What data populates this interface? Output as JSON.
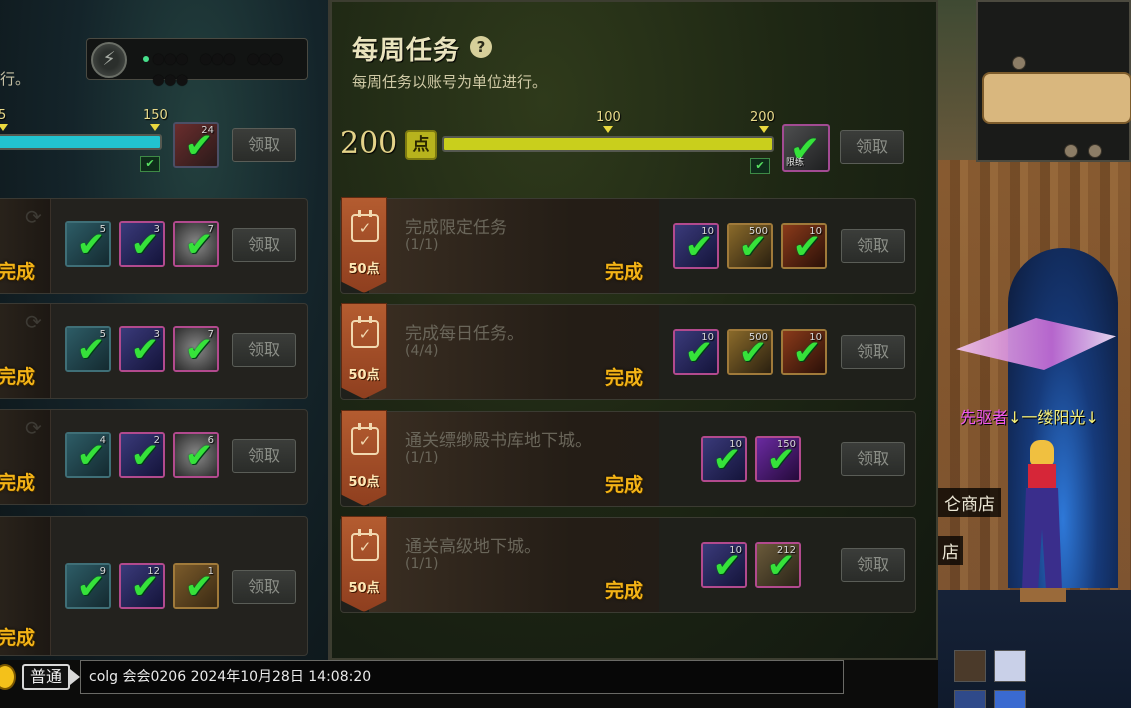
{
  "left_panel": {
    "desc_fragment": "行。",
    "power_display": "●●● ●●● ●●● ●●●",
    "progress": {
      "tick_left": "5",
      "tick_right": "150",
      "fill_fraction": 1.0,
      "fill_color": "#22c3cf"
    },
    "milestone_reward_count": "24",
    "claim_label": "领取",
    "tasks": [
      {
        "status": "完成",
        "rewards": [
          {
            "icon": "teal-box-icon",
            "count": "5"
          },
          {
            "icon": "purple-shard-icon",
            "count": "3"
          },
          {
            "icon": "silver-orb-icon",
            "count": "7"
          }
        ]
      },
      {
        "status": "完成",
        "rewards": [
          {
            "icon": "teal-box-icon",
            "count": "5"
          },
          {
            "icon": "purple-shard-icon",
            "count": "3"
          },
          {
            "icon": "silver-orb-icon",
            "count": "7"
          }
        ]
      },
      {
        "status": "完成",
        "rewards": [
          {
            "icon": "teal-box-icon",
            "count": "4"
          },
          {
            "icon": "purple-shard-icon",
            "count": "2"
          },
          {
            "icon": "silver-orb-icon",
            "count": "6"
          }
        ]
      },
      {
        "status": "完成",
        "rewards": [
          {
            "icon": "teal-box-icon",
            "count": "9"
          },
          {
            "icon": "purple-shard-icon",
            "count": "12"
          },
          {
            "icon": "gold-chest-icon",
            "count": "1"
          }
        ]
      }
    ]
  },
  "right_panel": {
    "title": "每周任务",
    "subtitle": "每周任务以账号为单位进行。",
    "score": "200",
    "score_unit": "点",
    "progress": {
      "tick_mid": "100",
      "tick_end": "200",
      "fill_fraction": 1.0,
      "fill_color": "#c9cf1c"
    },
    "milestone_reward_tag": "限练",
    "claim_label": "领取",
    "tasks": [
      {
        "name": "完成限定任务",
        "progress": "(1/1)",
        "points": "50点",
        "status": "完成",
        "rewards": [
          {
            "icon": "purple-shard-icon",
            "count": "10",
            "frame": "pink"
          },
          {
            "icon": "gold-coin-icon",
            "count": "500",
            "frame": "gold"
          },
          {
            "icon": "red-stone-icon",
            "count": "10",
            "frame": "gold"
          }
        ]
      },
      {
        "name": "完成每日任务。",
        "progress": "(4/4)",
        "points": "50点",
        "status": "完成",
        "rewards": [
          {
            "icon": "purple-shard-icon",
            "count": "10",
            "frame": "pink"
          },
          {
            "icon": "gold-coin-icon",
            "count": "500",
            "frame": "gold"
          },
          {
            "icon": "red-stone-icon",
            "count": "10",
            "frame": "gold"
          }
        ]
      },
      {
        "name": "通关缥缈殿书库地下城。",
        "progress": "(1/1)",
        "points": "50点",
        "status": "完成",
        "rewards": [
          {
            "icon": "purple-shard-icon",
            "count": "10",
            "frame": "pink"
          },
          {
            "icon": "violet-crystal-icon",
            "count": "150",
            "frame": "pink"
          }
        ]
      },
      {
        "name": "通关高级地下城。",
        "progress": "(1/1)",
        "points": "50点",
        "status": "完成",
        "rewards": [
          {
            "icon": "purple-shard-icon",
            "count": "10",
            "frame": "pink"
          },
          {
            "icon": "bronze-token-icon",
            "count": "212",
            "frame": "pink"
          }
        ]
      }
    ]
  },
  "world": {
    "player_name_a": "先驱者",
    "player_name_b": "↓一缕阳光↓",
    "npc_label": "仑商店",
    "npc_label_2": "店"
  },
  "chat": {
    "channel": "普通",
    "message": "colg 会会0206  2024年10月28日 14:08:20"
  },
  "colors": {
    "done": "#f3b316",
    "check": "#36e23a",
    "ribbon": "#a94d26"
  }
}
